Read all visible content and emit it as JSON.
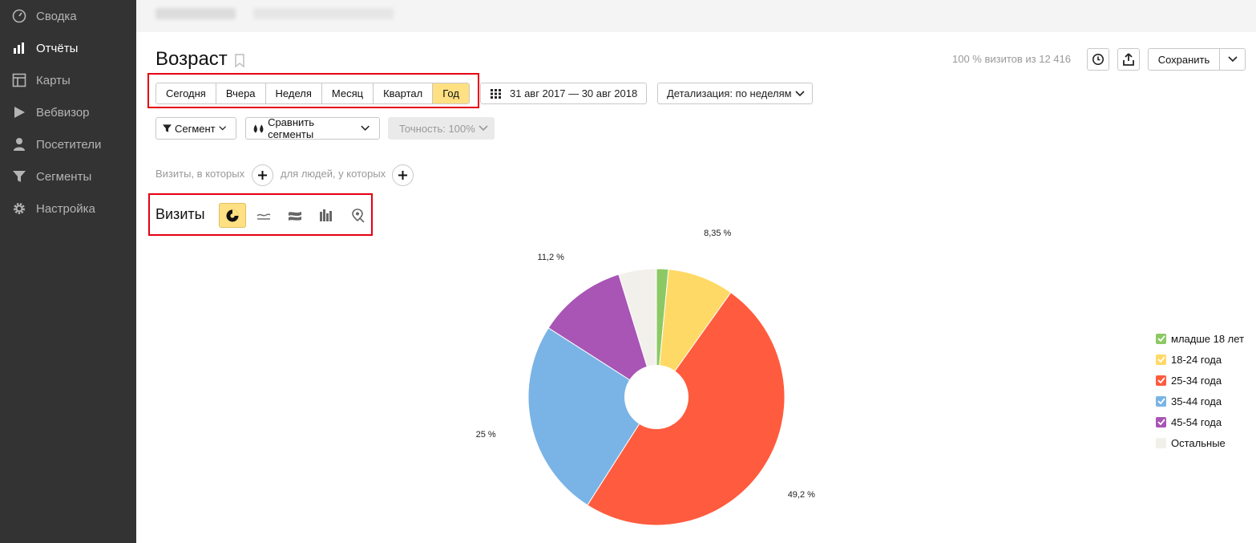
{
  "sidebar": {
    "items": [
      {
        "label": "Сводка",
        "icon": "gauge-icon",
        "active": false
      },
      {
        "label": "Отчёты",
        "icon": "bar-chart-icon",
        "active": true
      },
      {
        "label": "Карты",
        "icon": "map-layout-icon",
        "active": false
      },
      {
        "label": "Вебвизор",
        "icon": "play-icon",
        "active": false
      },
      {
        "label": "Посетители",
        "icon": "person-icon",
        "active": false
      },
      {
        "label": "Сегменты",
        "icon": "filter-icon",
        "active": false
      },
      {
        "label": "Настройка",
        "icon": "gear-icon",
        "active": false
      }
    ]
  },
  "header": {
    "title": "Возраст",
    "visits_note": "100 % визитов из 12 416",
    "save_label": "Сохранить"
  },
  "periods": [
    {
      "label": "Сегодня",
      "active": false
    },
    {
      "label": "Вчера",
      "active": false
    },
    {
      "label": "Неделя",
      "active": false
    },
    {
      "label": "Месяц",
      "active": false
    },
    {
      "label": "Квартал",
      "active": false
    },
    {
      "label": "Год",
      "active": true
    }
  ],
  "date_range": "31 авг 2017 — 30 авг 2018",
  "detail": "Детализация: по неделям",
  "segment_label": "Сегмент",
  "compare_label": "Сравнить сегменты",
  "accuracy_label": "Точность: 100%",
  "conditions": {
    "visits_text": "Визиты, в которых",
    "people_text": "для людей, у которых"
  },
  "chart_section": {
    "title": "Визиты",
    "types": [
      "pie-chart-icon",
      "line-chart-icon",
      "area-chart-icon",
      "bar-chart-icon",
      "map-pin-icon"
    ]
  },
  "chart_data": {
    "type": "pie",
    "donut": true,
    "slices": [
      {
        "name": "младше 18 лет",
        "value": 1.5,
        "label": "",
        "color": "#8cc965"
      },
      {
        "name": "18-24 года",
        "value": 8.35,
        "label": "8,35 %",
        "color": "#ffd965"
      },
      {
        "name": "25-34 года",
        "value": 49.2,
        "label": "49,2 %",
        "color": "#ff5b3e"
      },
      {
        "name": "35-44 года",
        "value": 25,
        "label": "25 %",
        "color": "#7ab4e6"
      },
      {
        "name": "45-54 года",
        "value": 11.2,
        "label": "11,2 %",
        "color": "#a855b6"
      },
      {
        "name": "Остальные",
        "value": 4.75,
        "label": "",
        "color": "#f2f0ea"
      }
    ],
    "legend_position": "right"
  }
}
